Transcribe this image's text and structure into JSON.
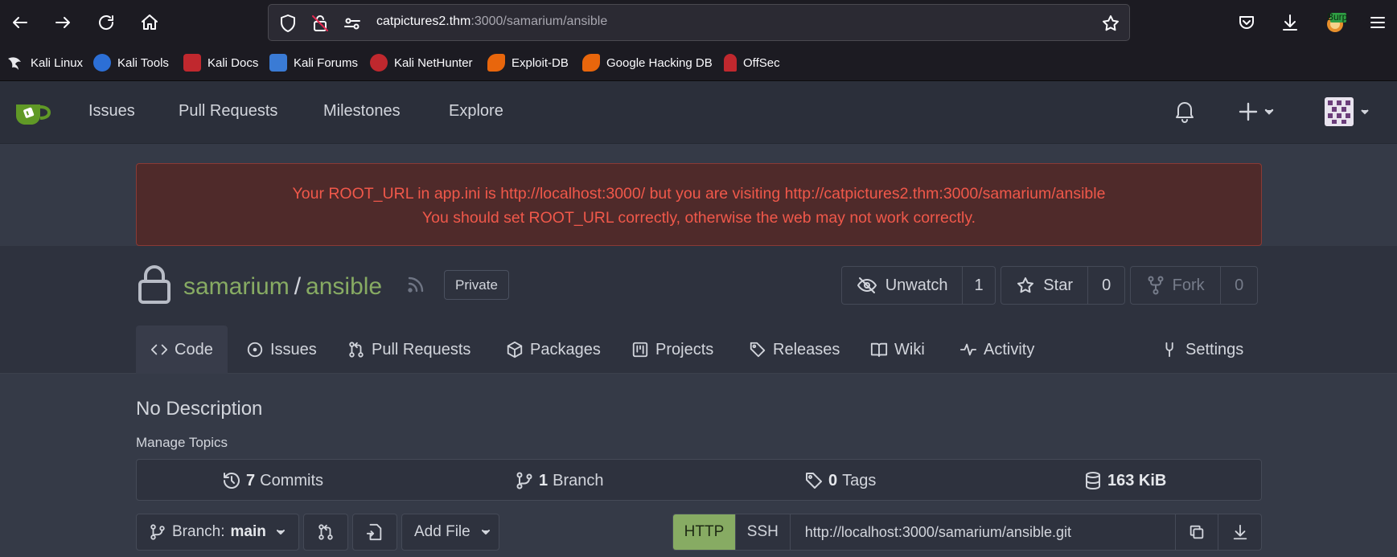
{
  "browser": {
    "url_host": "catpictures2.thm",
    "url_path": ":3000/samarium/ansible",
    "profile_badge": "Burp",
    "bookmarks": [
      {
        "label": "Kali Linux",
        "color": "#2f3440"
      },
      {
        "label": "Kali Tools",
        "color": "#2c6fd6"
      },
      {
        "label": "Kali Docs",
        "color": "#c0282e"
      },
      {
        "label": "Kali Forums",
        "color": "#3a7bd5"
      },
      {
        "label": "Kali NetHunter",
        "color": "#c0282e"
      },
      {
        "label": "Exploit-DB",
        "color": "#e8660c"
      },
      {
        "label": "Google Hacking DB",
        "color": "#e8660c"
      },
      {
        "label": "OffSec",
        "color": "#c0282e"
      }
    ]
  },
  "nav": {
    "items": [
      "Issues",
      "Pull Requests",
      "Milestones",
      "Explore"
    ],
    "accent": "#609926"
  },
  "warning": {
    "line1": "Your ROOT_URL in app.ini is http://localhost:3000/ but you are visiting http://catpictures2.thm:3000/samarium/ansible",
    "line2": "You should set ROOT_URL correctly, otherwise the web may not work correctly.",
    "color": "#f0584a"
  },
  "repo": {
    "owner": "samarium",
    "separator": "/",
    "name": "ansible",
    "visibility": "Private",
    "unwatch_label": "Unwatch",
    "watch_count": "1",
    "star_label": "Star",
    "star_count": "0",
    "fork_label": "Fork",
    "fork_count": "0"
  },
  "tabs": {
    "code": "Code",
    "issues": "Issues",
    "pulls": "Pull Requests",
    "packages": "Packages",
    "projects": "Projects",
    "releases": "Releases",
    "wiki": "Wiki",
    "activity": "Activity",
    "settings": "Settings"
  },
  "body": {
    "description": "No Description",
    "manage_topics": "Manage Topics",
    "commits_count": "7",
    "commits_label": "Commits",
    "branch_count": "1",
    "branch_label": "Branch",
    "tags_count": "0",
    "tags_label": "Tags",
    "size": "163 KiB",
    "branch_prefix": "Branch:",
    "branch_name": "main",
    "add_file": "Add File",
    "clone_http": "HTTP",
    "clone_ssh": "SSH",
    "clone_url": "http://localhost:3000/samarium/ansible.git"
  }
}
